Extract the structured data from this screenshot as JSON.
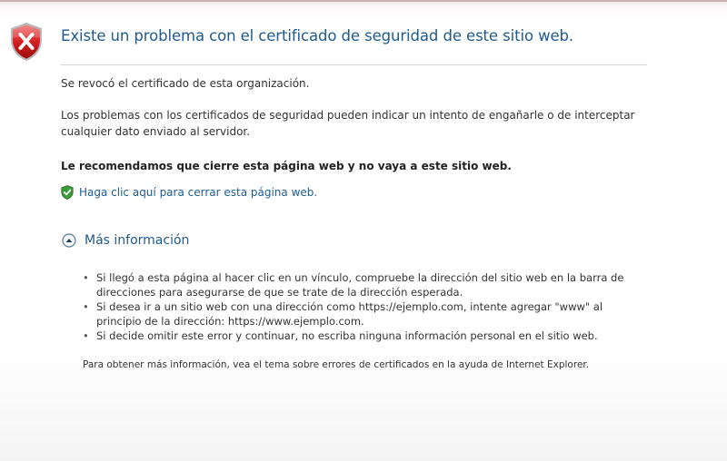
{
  "page": {
    "title": "Existe un problema con el certificado de seguridad de este sitio web.",
    "revoked_message": "Se revocó el certificado de esta organización.",
    "problems_message": "Los problemas con los certificados de seguridad pueden indicar un intento de engañarle o de interceptar cualquier dato enviado al servidor.",
    "recommendation": "Le recomendamos que cierre esta página web y no vaya a este sitio web.",
    "close_link": "Haga clic aquí para cerrar esta página web.",
    "more_info": {
      "label": "Más información",
      "expanded": true,
      "bullets": [
        "Si llegó a esta página al hacer clic en un vínculo, compruebe la dirección del sitio web en la barra de direcciones para asegurarse de que se trate de la dirección esperada.",
        "Si desea ir a un sitio web con una dirección como https://ejemplo.com, intente agregar \"www\" al principio de la dirección: https://www.ejemplo.com.",
        "Si decide omitir este error y continuar, no escriba ninguna información personal en el sitio web."
      ],
      "footer": "Para obtener más información, vea el tema sobre errores de certificados en la ayuda de Internet Explorer."
    }
  },
  "icons": {
    "error": "error-shield-icon",
    "safe": "green-shield-check-icon",
    "collapse": "chevron-up-circle-icon"
  },
  "colors": {
    "title": "#1f5a8c",
    "link": "#1c5c93",
    "error_red": "#c8102e",
    "safe_green": "#3c9a3a"
  }
}
